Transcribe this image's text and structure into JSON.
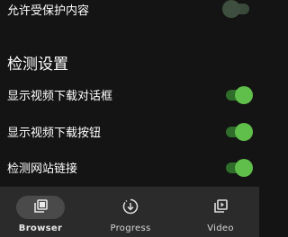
{
  "settings": {
    "allow_protected": {
      "label": "允许受保护内容",
      "enabled": false
    },
    "section_title": "检测设置",
    "items": [
      {
        "label": "显示视频下载对话框",
        "enabled": true
      },
      {
        "label": "显示视频下载按钮",
        "enabled": true
      },
      {
        "label": "检测网站链接",
        "enabled": true
      }
    ]
  },
  "colors": {
    "background": "#141414",
    "nav_background": "#2b2b2b",
    "switch_on": "#5fbf4a"
  },
  "bottom_nav": {
    "tabs": [
      {
        "label": "Browser",
        "icon": "browser-tabs-icon",
        "active": true
      },
      {
        "label": "Progress",
        "icon": "download-progress-icon",
        "active": false
      },
      {
        "label": "Video",
        "icon": "video-library-icon",
        "active": false
      }
    ]
  }
}
